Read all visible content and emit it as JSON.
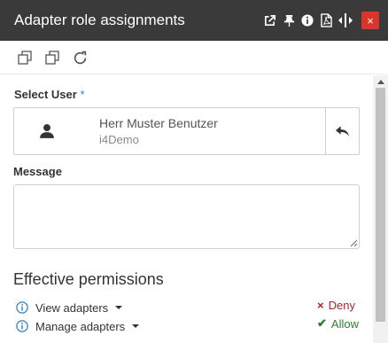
{
  "window": {
    "title": "Adapter role assignments",
    "close_glyph": "×"
  },
  "titlebar_icons": [
    "external-link-icon",
    "pin-icon",
    "info-icon",
    "pdf-icon",
    "expand-horizontal-icon"
  ],
  "toolbar": {
    "icons": [
      "copy-icon",
      "duplicate-icon",
      "refresh-icon"
    ]
  },
  "user_field": {
    "label": "Select User",
    "required_marker": "*",
    "name": "Herr Muster Benutzer",
    "subtitle": "i4Demo"
  },
  "message_field": {
    "label": "Message",
    "value": ""
  },
  "permissions": {
    "title": "Effective permissions",
    "items": [
      {
        "label": "View adapters"
      },
      {
        "label": "Manage adapters"
      }
    ],
    "legend": {
      "deny_glyph": "×",
      "deny_label": "Deny",
      "allow_glyph": "✔",
      "allow_label": "Allow"
    }
  },
  "colors": {
    "titlebar": "#3a3a3a",
    "close": "#d9362b",
    "accent": "#2a7fbf",
    "deny": "#a52a2a",
    "allow": "#2e7d32"
  }
}
